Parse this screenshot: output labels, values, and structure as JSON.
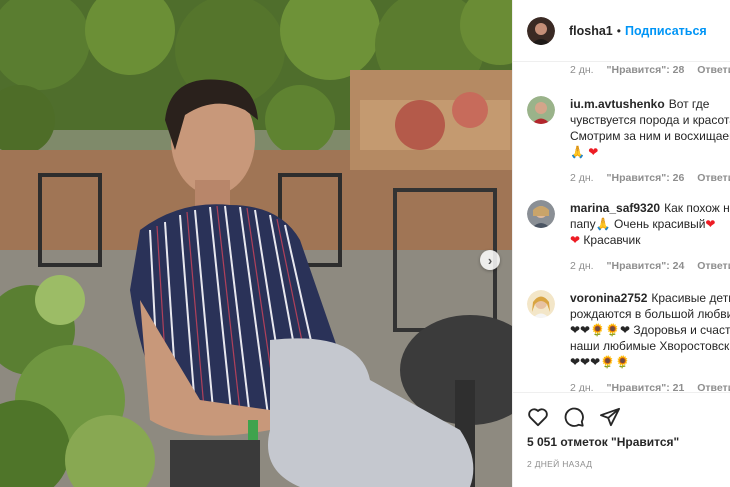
{
  "post": {
    "author": "flosha1",
    "separator": "•",
    "follow_label": "Подписаться",
    "next_arrow": "›"
  },
  "first_meta": {
    "time": "2 дн.",
    "likes": "\"Нравится\": 28",
    "reply": "Ответить"
  },
  "comments": [
    {
      "username": "iu.m.avtushenko",
      "text": "Вот где чувствуется порода и красота! Смотрим за ним и восхищаемся! 🙏",
      "emoji_tail": "❤",
      "time": "2 дн.",
      "likes": "\"Нравится\": 26",
      "reply": "Ответить"
    },
    {
      "username": "marina_saf9320",
      "text": "Как похож на папу🙏 Очень красивый",
      "emoji_mid": "❤",
      "emoji_line2": "❤",
      "text2": "Красавчик",
      "time": "2 дн.",
      "likes": "\"Нравится\": 24",
      "reply": "Ответить"
    },
    {
      "username": "voronina2752",
      "text": "Красивые дети рождаются в большой любви",
      "emoji_row": "❤❤🌻🌻❤",
      "text2": "Здоровья и счастья наши любимые Хворостовские!",
      "emoji_tail": "❤❤❤🌻🌻",
      "time": "2 дн.",
      "likes": "\"Нравится\": 21",
      "reply": "Ответить"
    }
  ],
  "actions": {
    "likes_count": "5 051 отметок \"Нравится\"",
    "date": "2 дней назад"
  },
  "colors": {
    "link": "#0095f6",
    "muted": "#8e8e8e",
    "text": "#262626",
    "heart": "#ed1c24"
  }
}
